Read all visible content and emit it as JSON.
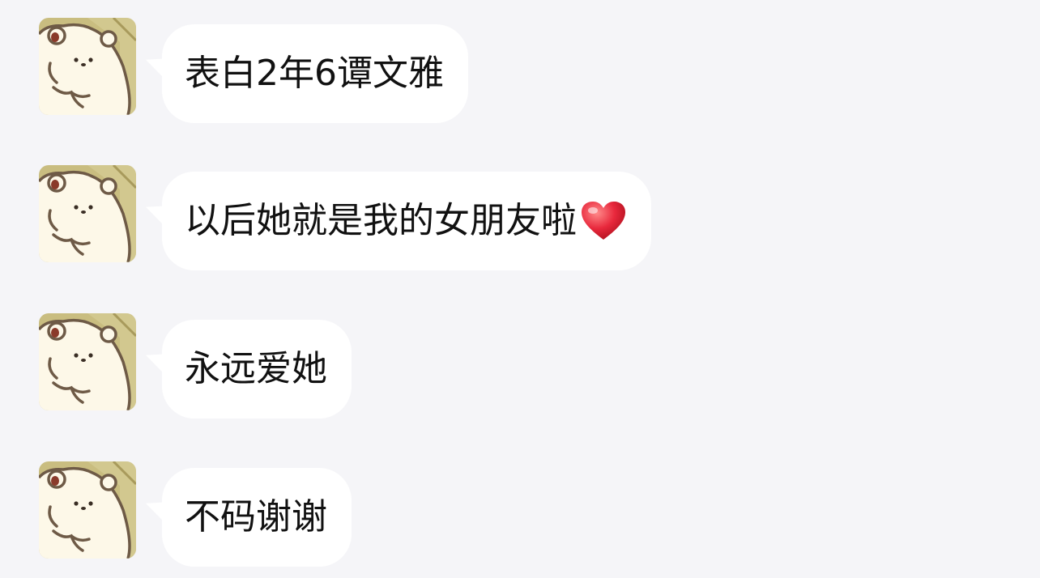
{
  "messages": [
    {
      "text": "表白2年6谭文雅",
      "avatar": "bear-avatar-icon",
      "has_heart": false
    },
    {
      "text": "以后她就是我的女朋友啦",
      "avatar": "bear-avatar-icon",
      "has_heart": true
    },
    {
      "text": "永远爱她",
      "avatar": "bear-avatar-icon",
      "has_heart": false
    },
    {
      "text": "不码谢谢",
      "avatar": "bear-avatar-icon",
      "has_heart": false
    }
  ],
  "colors": {
    "background": "#f5f5f8",
    "bubble": "#ffffff",
    "text": "#111111",
    "heart": "#e8283c",
    "avatar_bg": "#c9bd80"
  }
}
